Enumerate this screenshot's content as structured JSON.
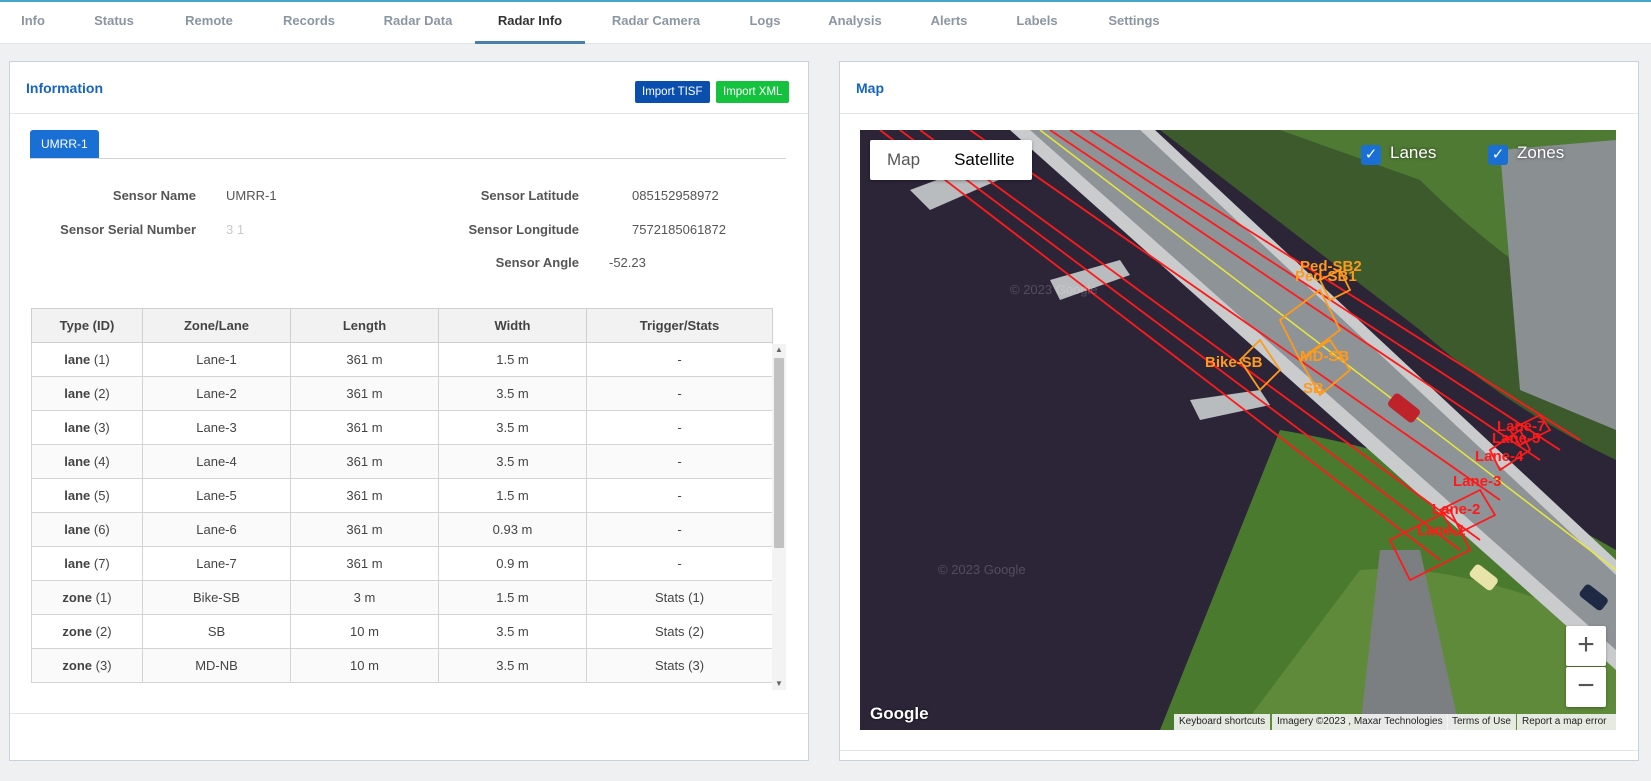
{
  "nav": {
    "tabs": [
      {
        "label": "Info"
      },
      {
        "label": "Status"
      },
      {
        "label": "Remote"
      },
      {
        "label": "Records"
      },
      {
        "label": "Radar Data"
      },
      {
        "label": "Radar Info"
      },
      {
        "label": "Radar Camera"
      },
      {
        "label": "Logs"
      },
      {
        "label": "Analysis"
      },
      {
        "label": "Alerts"
      },
      {
        "label": "Labels"
      },
      {
        "label": "Settings"
      }
    ],
    "active": "Radar Info"
  },
  "info_panel": {
    "title": "Information",
    "import_tisf_label": "Import TISF",
    "import_xml_label": "Import XML",
    "sensor_tab": "UMRR-1",
    "fields": {
      "sensor_name_label": "Sensor Name",
      "sensor_name_value": "UMRR-1",
      "serial_label": "Sensor Serial Number",
      "serial_value": "3    1",
      "latitude_label": "Sensor Latitude",
      "latitude_value": "085152958972",
      "longitude_label": "Sensor Longitude",
      "longitude_value": "7572185061872",
      "angle_label": "Sensor Angle",
      "angle_value": "-52.23"
    },
    "table": {
      "headers": [
        "Type (ID)",
        "Zone/Lane",
        "Length",
        "Width",
        "Trigger/Stats"
      ],
      "rows": [
        {
          "type": "lane",
          "id": "(1)",
          "name": "Lane-1",
          "length": "361 m",
          "width": "1.5 m",
          "trigger": "-"
        },
        {
          "type": "lane",
          "id": "(2)",
          "name": "Lane-2",
          "length": "361 m",
          "width": "3.5 m",
          "trigger": "-"
        },
        {
          "type": "lane",
          "id": "(3)",
          "name": "Lane-3",
          "length": "361 m",
          "width": "3.5 m",
          "trigger": "-"
        },
        {
          "type": "lane",
          "id": "(4)",
          "name": "Lane-4",
          "length": "361 m",
          "width": "3.5 m",
          "trigger": "-"
        },
        {
          "type": "lane",
          "id": "(5)",
          "name": "Lane-5",
          "length": "361 m",
          "width": "1.5 m",
          "trigger": "-"
        },
        {
          "type": "lane",
          "id": "(6)",
          "name": "Lane-6",
          "length": "361 m",
          "width": "0.93 m",
          "trigger": "-"
        },
        {
          "type": "lane",
          "id": "(7)",
          "name": "Lane-7",
          "length": "361 m",
          "width": "0.9 m",
          "trigger": "-"
        },
        {
          "type": "zone",
          "id": "(1)",
          "name": "Bike-SB",
          "length": "3 m",
          "width": "1.5 m",
          "trigger": "Stats (1)"
        },
        {
          "type": "zone",
          "id": "(2)",
          "name": "SB",
          "length": "10 m",
          "width": "3.5 m",
          "trigger": "Stats (2)"
        },
        {
          "type": "zone",
          "id": "(3)",
          "name": "MD-NB",
          "length": "10 m",
          "width": "3.5 m",
          "trigger": "Stats (3)"
        }
      ]
    }
  },
  "map_panel": {
    "title": "Map",
    "map_btn": "Map",
    "satellite_btn": "Satellite",
    "lanes_label": "Lanes",
    "zones_label": "Zones",
    "zoom_in": "+",
    "zoom_out": "−",
    "google": "Google",
    "attribution": {
      "shortcuts": "Keyboard shortcuts",
      "imagery": "Imagery ©2023 , Maxar Technologies",
      "terms": "Terms of Use",
      "report": "Report a map error"
    },
    "watermark": "© 2023 Google",
    "lane_labels": [
      "Lane-1",
      "Lane-2",
      "Lane-3",
      "Lane-4",
      "Lane-5",
      "Lane-7"
    ],
    "zone_labels": [
      "Bike-SB",
      "SB",
      "MD-SB",
      "Ped-SB2",
      "Ped-SB1"
    ],
    "colors": {
      "lane": "#ff1a1a",
      "zone": "#ff9a1a",
      "center_line": "#e8e83a"
    }
  }
}
